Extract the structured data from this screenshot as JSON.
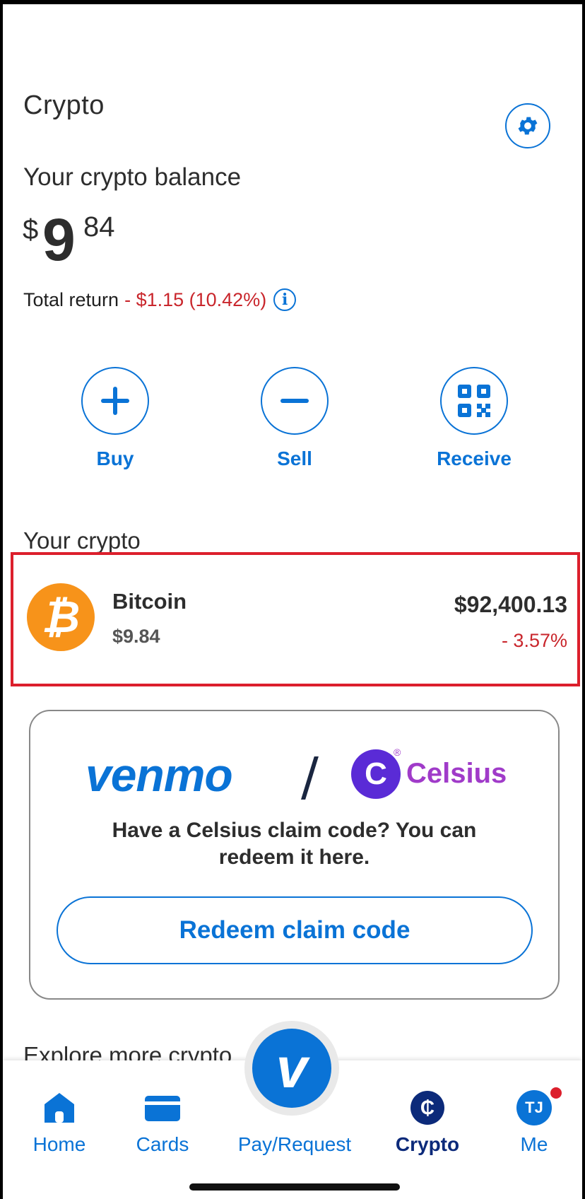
{
  "header": {
    "title": "Crypto"
  },
  "balance": {
    "label": "Your crypto balance",
    "currency": "$",
    "whole": "9",
    "cents": "84"
  },
  "total_return": {
    "label": "Total return",
    "value": "- $1.15 (10.42%)"
  },
  "actions": [
    {
      "label": "Buy",
      "icon": "plus-icon"
    },
    {
      "label": "Sell",
      "icon": "minus-icon"
    },
    {
      "label": "Receive",
      "icon": "qr-code-icon"
    }
  ],
  "your_crypto": {
    "title": "Your crypto",
    "items": [
      {
        "name": "Bitcoin",
        "holding": "$9.84",
        "price": "$92,400.13",
        "change": "- 3.57%",
        "icon": "bitcoin-icon"
      }
    ]
  },
  "promo": {
    "brand_left": "venmo",
    "brand_right": "Celsius",
    "text": "Have a Celsius claim code? You can redeem it here.",
    "button": "Redeem claim code"
  },
  "explore": {
    "title": "Explore more crypto"
  },
  "tabbar": {
    "home": "Home",
    "cards": "Cards",
    "pay": "Pay/Request",
    "crypto": "Crypto",
    "me": "Me",
    "avatar_initials": "TJ"
  },
  "colors": {
    "accent": "#0a73d6",
    "negative": "#c9262c",
    "highlight_border": "#dc1f2c",
    "bitcoin": "#f7931a"
  }
}
